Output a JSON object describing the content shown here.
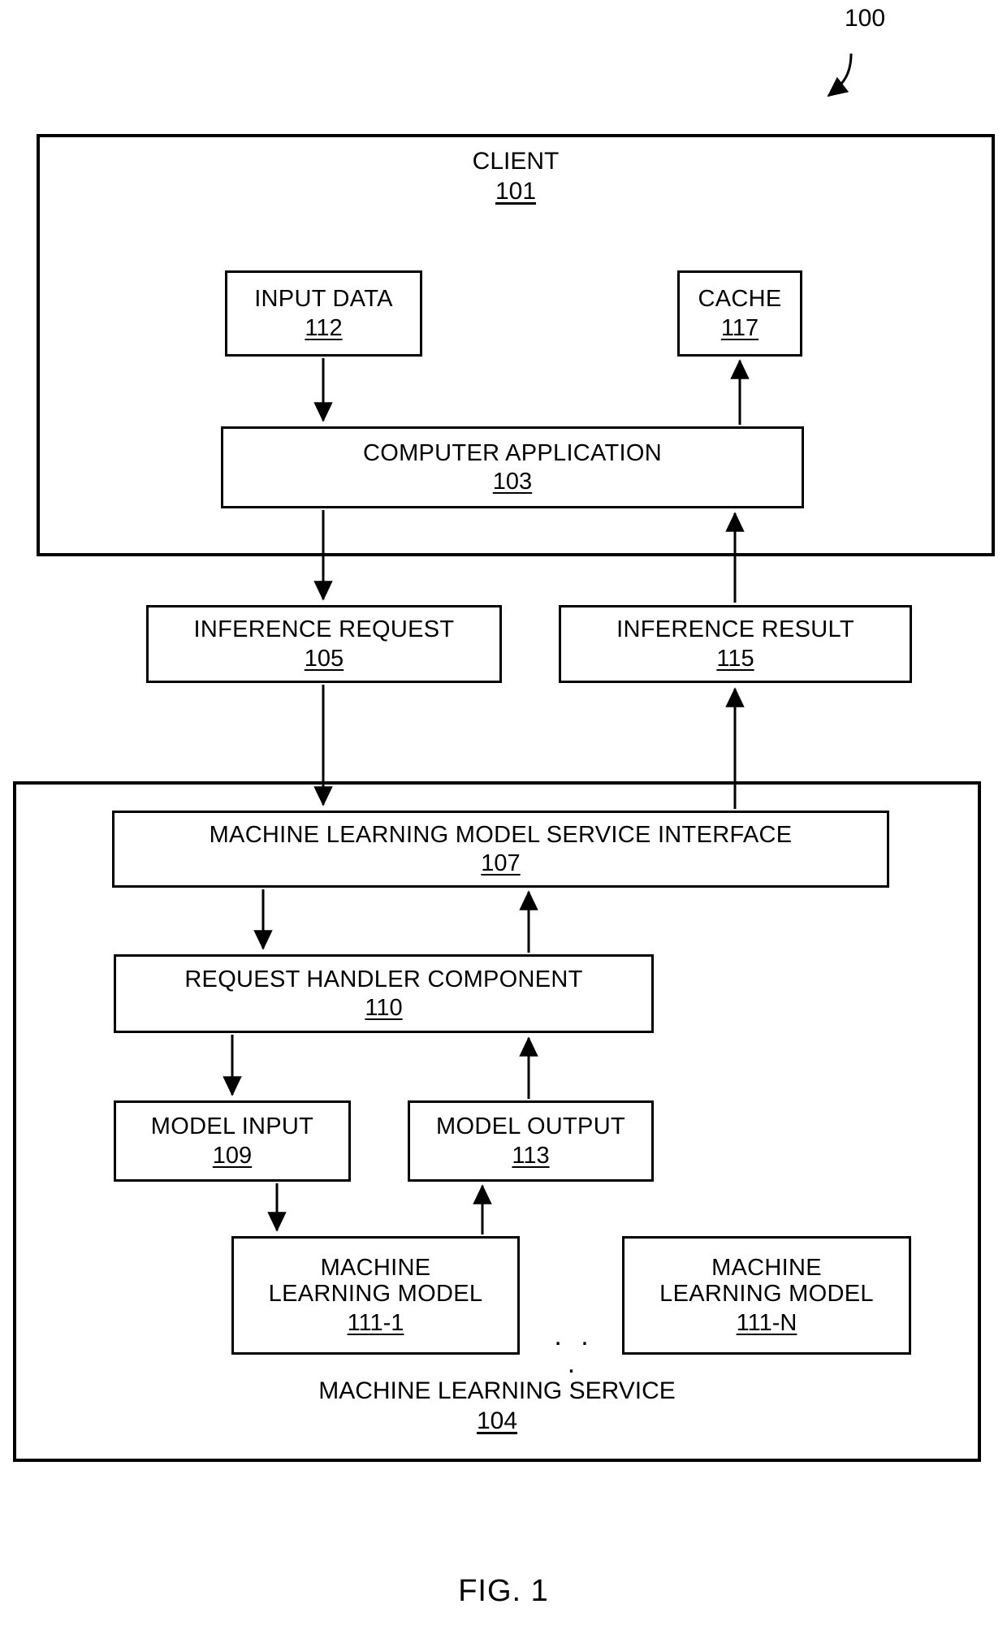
{
  "figure": {
    "number_label": "100",
    "caption": "FIG. 1"
  },
  "client": {
    "title": "CLIENT",
    "ref": "101",
    "input_data": {
      "title": "INPUT DATA",
      "ref": "112"
    },
    "cache": {
      "title": "CACHE",
      "ref": "117"
    },
    "computer_application": {
      "title": "COMPUTER APPLICATION",
      "ref": "103"
    }
  },
  "messages": {
    "inference_request": {
      "title": "INFERENCE REQUEST",
      "ref": "105"
    },
    "inference_result": {
      "title": "INFERENCE RESULT",
      "ref": "115"
    }
  },
  "machine_learning_service": {
    "title": "MACHINE LEARNING SERVICE",
    "ref": "104",
    "service_interface": {
      "title": "MACHINE LEARNING MODEL SERVICE INTERFACE",
      "ref": "107"
    },
    "request_handler": {
      "title": "REQUEST HANDLER COMPONENT",
      "ref": "110"
    },
    "model_input": {
      "title": "MODEL INPUT",
      "ref": "109"
    },
    "model_output": {
      "title": "MODEL OUTPUT",
      "ref": "113"
    },
    "models": [
      {
        "title": "MACHINE\nLEARNING MODEL",
        "ref": "111-1"
      },
      {
        "title": "MACHINE\nLEARNING MODEL",
        "ref": "111-N"
      }
    ],
    "ellipsis": ". . ."
  },
  "colors": {
    "stroke": "#000000",
    "background": "#ffffff"
  }
}
